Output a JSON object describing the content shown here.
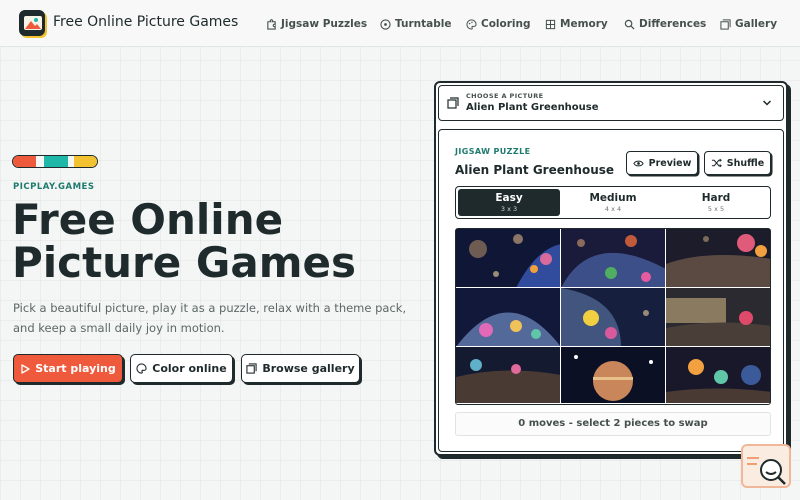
{
  "header": {
    "brand": "Free Online Picture Games",
    "nav": [
      {
        "label": "Jigsaw Puzzles",
        "icon": "puzzle-icon"
      },
      {
        "label": "Turntable",
        "icon": "turntable-icon"
      },
      {
        "label": "Coloring",
        "icon": "palette-icon"
      },
      {
        "label": "Memory",
        "icon": "grid-icon"
      },
      {
        "label": "Differences",
        "icon": "search-icon"
      },
      {
        "label": "Gallery",
        "icon": "gallery-icon"
      }
    ]
  },
  "hero": {
    "stripe_colors": [
      "#ef5a3d",
      "#f4f6f5",
      "#1fb8a8",
      "#f4f6f5",
      "#f2c230"
    ],
    "eyebrow": "PICPLAY.GAMES",
    "title_line1": "Free Online",
    "title_line2": "Picture Games",
    "subtitle": "Pick a beautiful picture, play it as a puzzle, relax with a theme pack, and keep a small daily joy in motion.",
    "buttons": {
      "start": "Start playing",
      "color": "Color online",
      "browse": "Browse gallery"
    }
  },
  "panel": {
    "picker": {
      "label": "CHOOSE A PICTURE",
      "value": "Alien Plant Greenhouse"
    },
    "game": {
      "eyebrow": "JIGSAW PUZZLE",
      "title": "Alien Plant Greenhouse",
      "preview": "Preview",
      "shuffle": "Shuffle",
      "difficulties": [
        {
          "label": "Easy",
          "grid": "3 x 3",
          "active": true
        },
        {
          "label": "Medium",
          "grid": "4 x 4",
          "active": false
        },
        {
          "label": "Hard",
          "grid": "5 x 5",
          "active": false
        }
      ],
      "status": "0 moves - select 2 pieces to swap"
    }
  },
  "colors": {
    "accent": "#ef5a3d",
    "teal": "#1f7a6e",
    "ink": "#1e2a2b",
    "yellow": "#f2c230"
  }
}
